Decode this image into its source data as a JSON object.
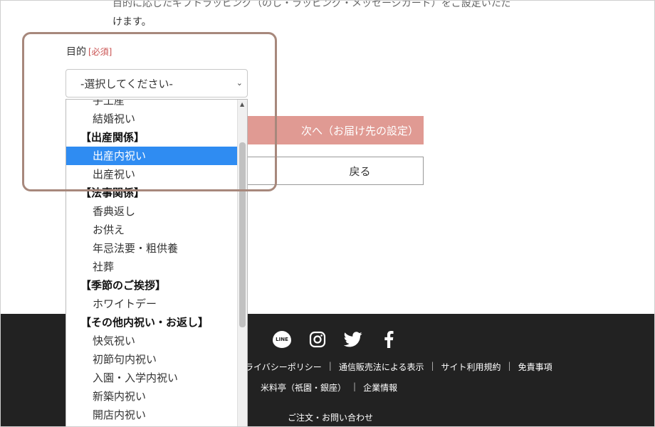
{
  "intro": {
    "line1": "目的に応じたギフトラッピング（のし・ラッピング・メッセージカード）をご設定いただ",
    "line2": "けます。"
  },
  "form": {
    "purpose_label": "目的",
    "required_badge": "[必須]",
    "select_value": "-選択してください-"
  },
  "buttons": {
    "next_label": "次へ（お届け先の設定）",
    "back_label": "戻る"
  },
  "dropdown": {
    "items": [
      {
        "label": "手土産",
        "type": "option"
      },
      {
        "label": "結婚祝い",
        "type": "option"
      },
      {
        "label": "【出産関係】",
        "type": "group"
      },
      {
        "label": "出産内祝い",
        "type": "option",
        "selected": true
      },
      {
        "label": "出産祝い",
        "type": "option"
      },
      {
        "label": "【法事関係】",
        "type": "group"
      },
      {
        "label": "香典返し",
        "type": "option"
      },
      {
        "label": "お供え",
        "type": "option"
      },
      {
        "label": "年忌法要・粗供養",
        "type": "option"
      },
      {
        "label": "社葬",
        "type": "option"
      },
      {
        "label": "【季節のご挨拶】",
        "type": "group"
      },
      {
        "label": "ホワイトデー",
        "type": "option"
      },
      {
        "label": "【その他内祝い・お返し】",
        "type": "group"
      },
      {
        "label": "快気祝い",
        "type": "option"
      },
      {
        "label": "初節句内祝い",
        "type": "option"
      },
      {
        "label": "入園・入学内祝い",
        "type": "option"
      },
      {
        "label": "新築内祝い",
        "type": "option"
      },
      {
        "label": "開店内祝い",
        "type": "option"
      }
    ]
  },
  "footer": {
    "social_icons": [
      "line-icon",
      "instagram-icon",
      "twitter-icon",
      "facebook-icon"
    ],
    "line_logo_text": "LINE",
    "links_row1": [
      "プライバシーポリシー",
      "通信販売法による表示",
      "サイト利用規約",
      "免責事項"
    ],
    "links_row2": [
      "米料亭（祇園・銀座）",
      "企業情報"
    ],
    "contact": "ご注文・お問い合わせ"
  },
  "colors": {
    "accent_button": "#e09a93",
    "selected_option": "#2f8cf2",
    "highlight_frame": "#a7887c",
    "footer_bg": "#222222",
    "required_text": "#c9504f"
  }
}
